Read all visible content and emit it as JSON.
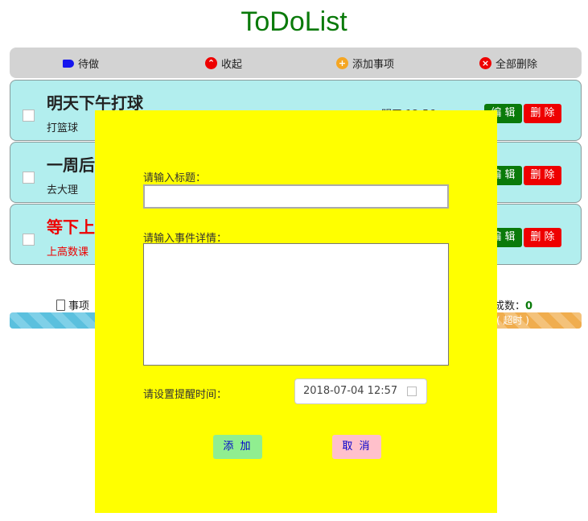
{
  "app": {
    "title": "ToDoList"
  },
  "toolbar": {
    "todo_label": "待做",
    "collapse_label": "收起",
    "add_label": "添加事项",
    "delete_all_label": "全部删除"
  },
  "tasks": [
    {
      "title": "明天下午打球",
      "detail": "打篮球",
      "time": "明天 12:56",
      "urgent": false
    },
    {
      "title": "一周后",
      "detail": "去大理",
      "time": "",
      "urgent": false
    },
    {
      "title": "等下上",
      "detail": "上高数课",
      "time": "",
      "urgent": true
    }
  ],
  "task_buttons": {
    "edit": "编 辑",
    "delete": "删 除"
  },
  "stats": {
    "items_label": "事项",
    "completed_label": "成数：",
    "completed_count": "0",
    "overdue_label": "( 超时 )"
  },
  "modal": {
    "title_label": "请输入标题：",
    "title_value": "",
    "detail_label": "请输入事件详情：",
    "detail_value": "",
    "time_label": "请设置提醒时间：",
    "time_value": "2018-07-04 12:57",
    "add_button": "添 加",
    "cancel_button": "取 消"
  },
  "colors": {
    "accent": "#0a7a0a",
    "modal_bg": "#ffff00",
    "task_bg": "#b2eeee",
    "danger": "#ee0000"
  }
}
